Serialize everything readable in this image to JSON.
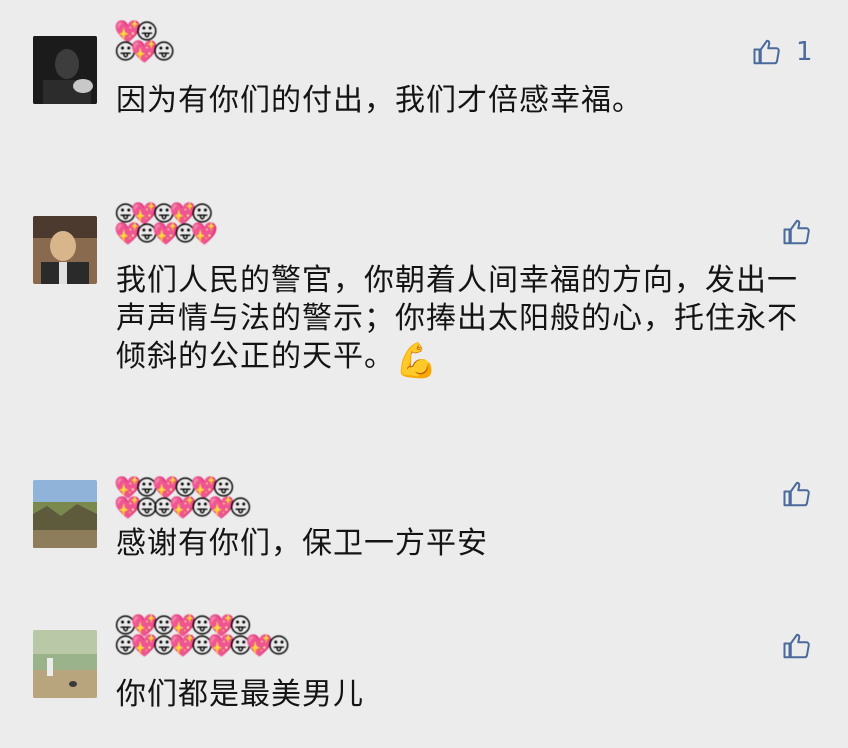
{
  "comments": [
    {
      "name_row1": "💖😛",
      "name_row2": "😛💖😛",
      "text": "因为有你们的付出，我们才倍感幸福。",
      "likes": "1",
      "like_icon": "thumbs-up-outline",
      "avatar_colors": [
        "#1c1c1c",
        "#3a3a3a",
        "#c8c8c8"
      ]
    },
    {
      "name_row1": "😛💖😛💖😛",
      "name_row2": "💖😛💖😛💖",
      "text": "我们人民的警官，你朝着人间幸福的方向，发出一声声情与法的警示；你捧出太阳般的心，托住永不倾斜的公正的天平。",
      "emoji": "💪",
      "likes": "",
      "like_icon": "thumbs-up-outline",
      "avatar_colors": [
        "#6d4f3a",
        "#d9b58c",
        "#2a2a2a"
      ]
    },
    {
      "name_row1": "💖😛💖😛💖😛",
      "name_row2": "💖😛😛💖😛💖😛",
      "text": "感谢有你们，保卫一方平安",
      "likes": "",
      "like_icon": "thumbs-up-outline",
      "avatar_colors": [
        "#8fb3d9",
        "#7a8a4e",
        "#5e5a3c"
      ]
    },
    {
      "name_row1": "😛💖😛💖😛💖😛",
      "name_row2": "😛💖😛💖😛💖😛💖😛",
      "text": "你们都是最美男儿",
      "likes": "",
      "like_icon": "thumbs-up-outline",
      "avatar_colors": [
        "#9bb38a",
        "#b8a57d",
        "#6d7f5c"
      ]
    }
  ]
}
